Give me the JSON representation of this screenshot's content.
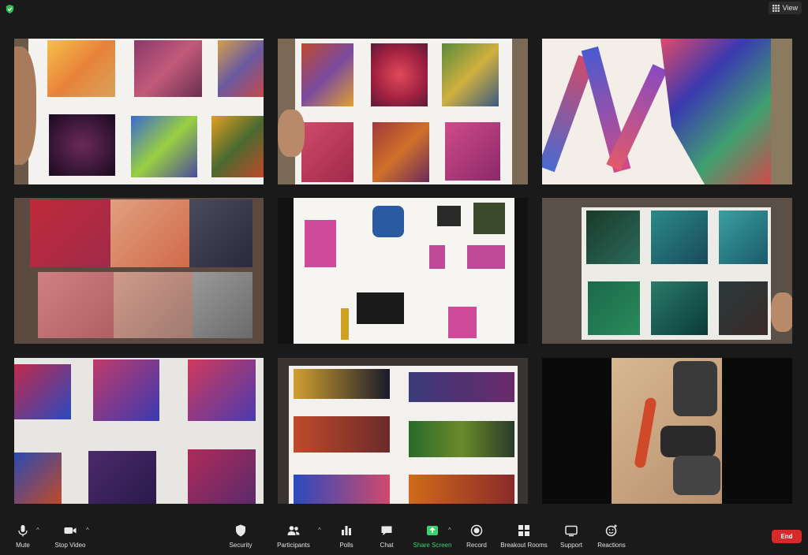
{
  "top": {
    "view_label": "View"
  },
  "toolbar": {
    "mute": "Mute",
    "stop_video": "Stop Video",
    "security": "Security",
    "participants": "Participants",
    "polls": "Polls",
    "chat": "Chat",
    "share_screen": "Share Screen",
    "record": "Record",
    "breakout_rooms": "Breakout Rooms",
    "support": "Support",
    "reactions": "Reactions",
    "end": "End"
  },
  "colors": {
    "background": "#1a1a1a",
    "share_green": "#3bd16f",
    "end_red": "#d42a2a",
    "shield_green": "#2fbf4f"
  },
  "icons": [
    "shield-check-icon",
    "grid-view-icon",
    "microphone-icon",
    "video-camera-icon",
    "security-shield-icon",
    "participants-icon",
    "polls-icon",
    "chat-icon",
    "share-screen-icon",
    "record-icon",
    "breakout-rooms-icon",
    "support-icon",
    "reactions-icon"
  ]
}
